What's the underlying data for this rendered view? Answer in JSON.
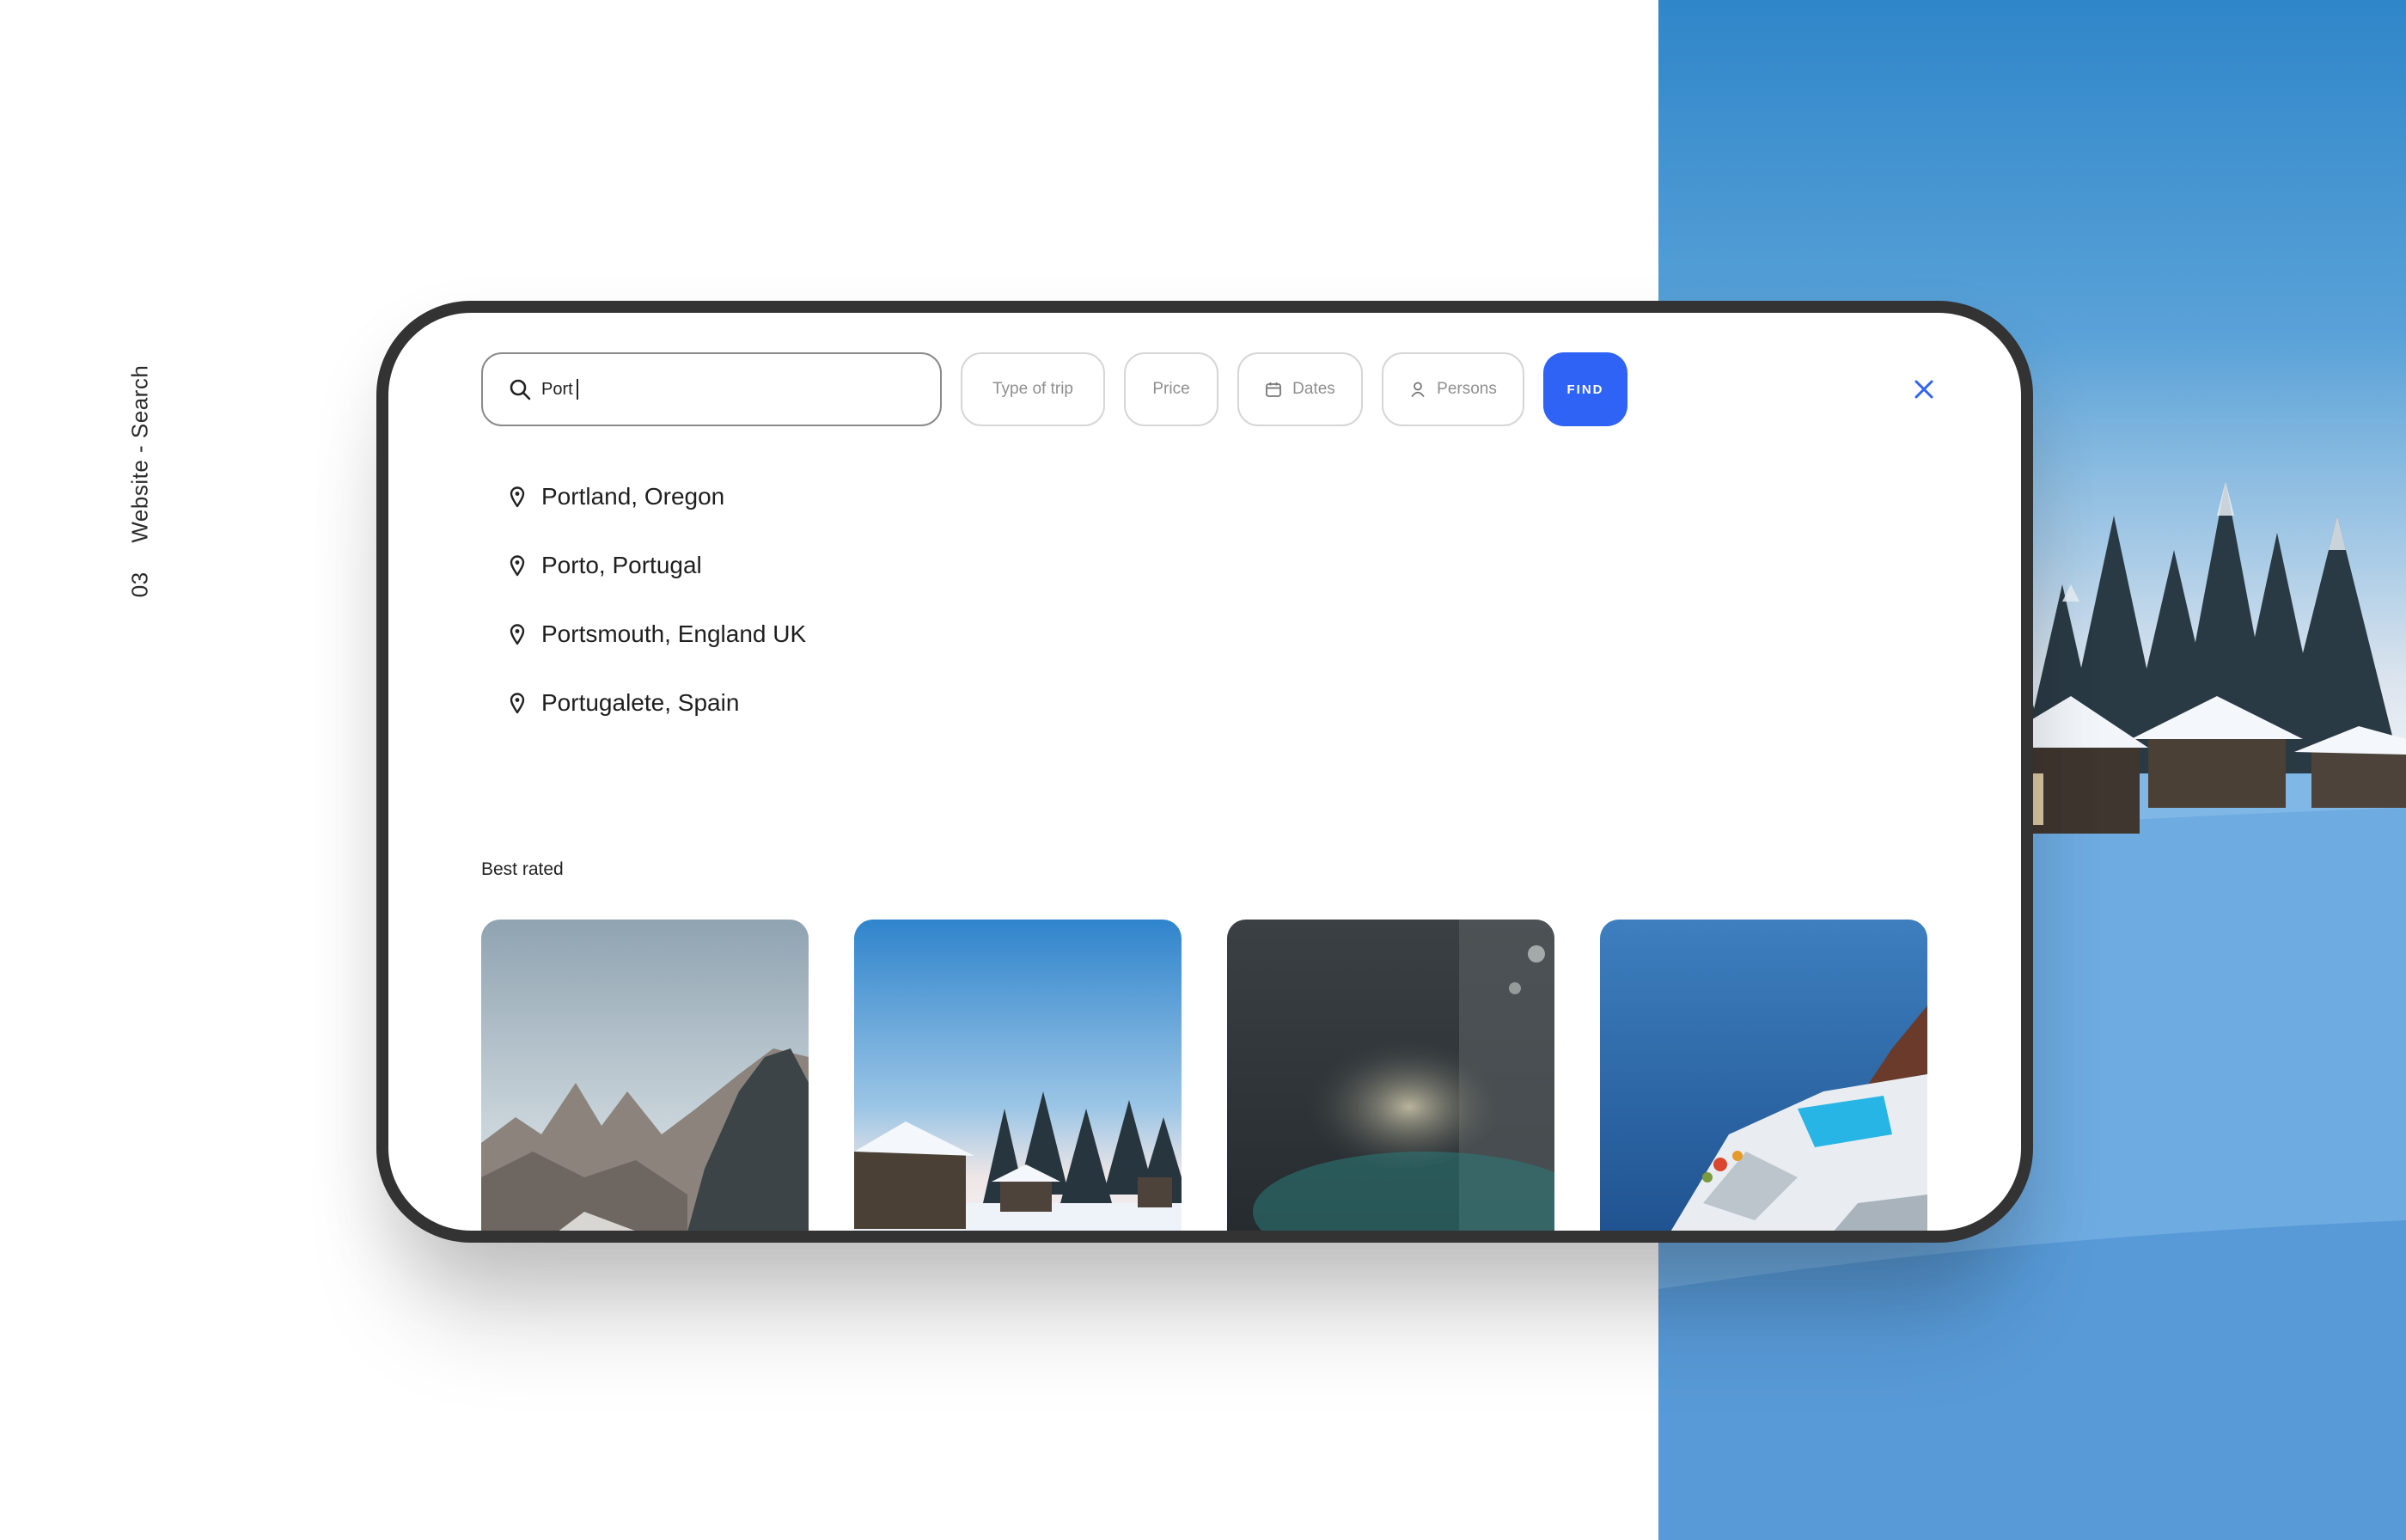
{
  "caption": {
    "number": "03",
    "text": "Website - Search"
  },
  "search": {
    "value": "Port"
  },
  "filters": {
    "type_of_trip": "Type of trip",
    "price": "Price",
    "dates": "Dates",
    "persons": "Persons"
  },
  "find_label": "FIND",
  "suggestions": [
    {
      "label": "Portland, Oregon"
    },
    {
      "label": "Porto, Portugal"
    },
    {
      "label": "Portsmouth, England UK"
    },
    {
      "label": "Portugalete, Spain"
    }
  ],
  "best_rated": {
    "title": "Best rated",
    "cards": [
      "mountain-peaks-photo",
      "snowy-cabins-photo",
      "blurred-city-photo",
      "santorini-pool-photo"
    ]
  },
  "colors": {
    "accent": "#2f63f6",
    "frame": "#333333",
    "close": "#2f63f6"
  }
}
